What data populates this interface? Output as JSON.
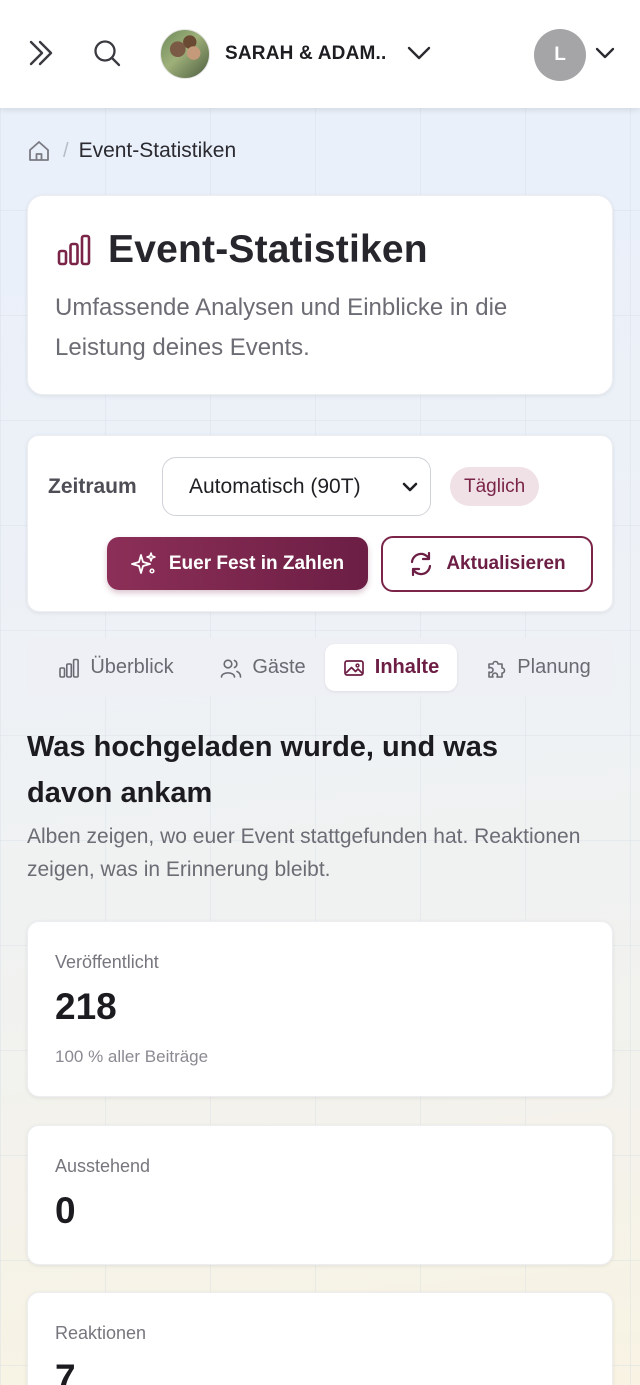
{
  "topbar": {
    "event_name": "SARAH & ADAM...",
    "user_initial": "L"
  },
  "breadcrumb": {
    "current": "Event-Statistiken"
  },
  "header": {
    "title": "Event-Statistiken",
    "description": "Umfassende Analysen und Einblicke in die Leistung deines Events."
  },
  "filters": {
    "zeitraum_label": "Zeitraum",
    "zeitraum_value": "Automatisch (90T)",
    "granularity_badge": "Täglich",
    "primary_button": "Euer Fest in Zahlen",
    "secondary_button": "Aktualisieren"
  },
  "tabs": [
    {
      "label": "Überblick",
      "icon": "bar-chart-icon",
      "active": false
    },
    {
      "label": "Gäste",
      "icon": "users-icon",
      "active": false
    },
    {
      "label": "Inhalte",
      "icon": "image-icon",
      "active": true
    },
    {
      "label": "Planung",
      "icon": "puzzle-icon",
      "active": false
    }
  ],
  "section": {
    "title": "Was hochgeladen wurde, und was davon ankam",
    "description": "Alben zeigen, wo euer Event stattgefunden hat. Reaktionen zeigen, was in Erinnerung bleibt."
  },
  "stats": [
    {
      "label": "Veröffentlicht",
      "value": "218",
      "sub": "100 % aller Beiträge"
    },
    {
      "label": "Ausstehend",
      "value": "0"
    },
    {
      "label": "Reaktionen",
      "value": "7"
    }
  ],
  "colors": {
    "brand": "#7a2548",
    "brand_dark": "#6c1e44",
    "badge_bg": "#f0e1e7"
  }
}
